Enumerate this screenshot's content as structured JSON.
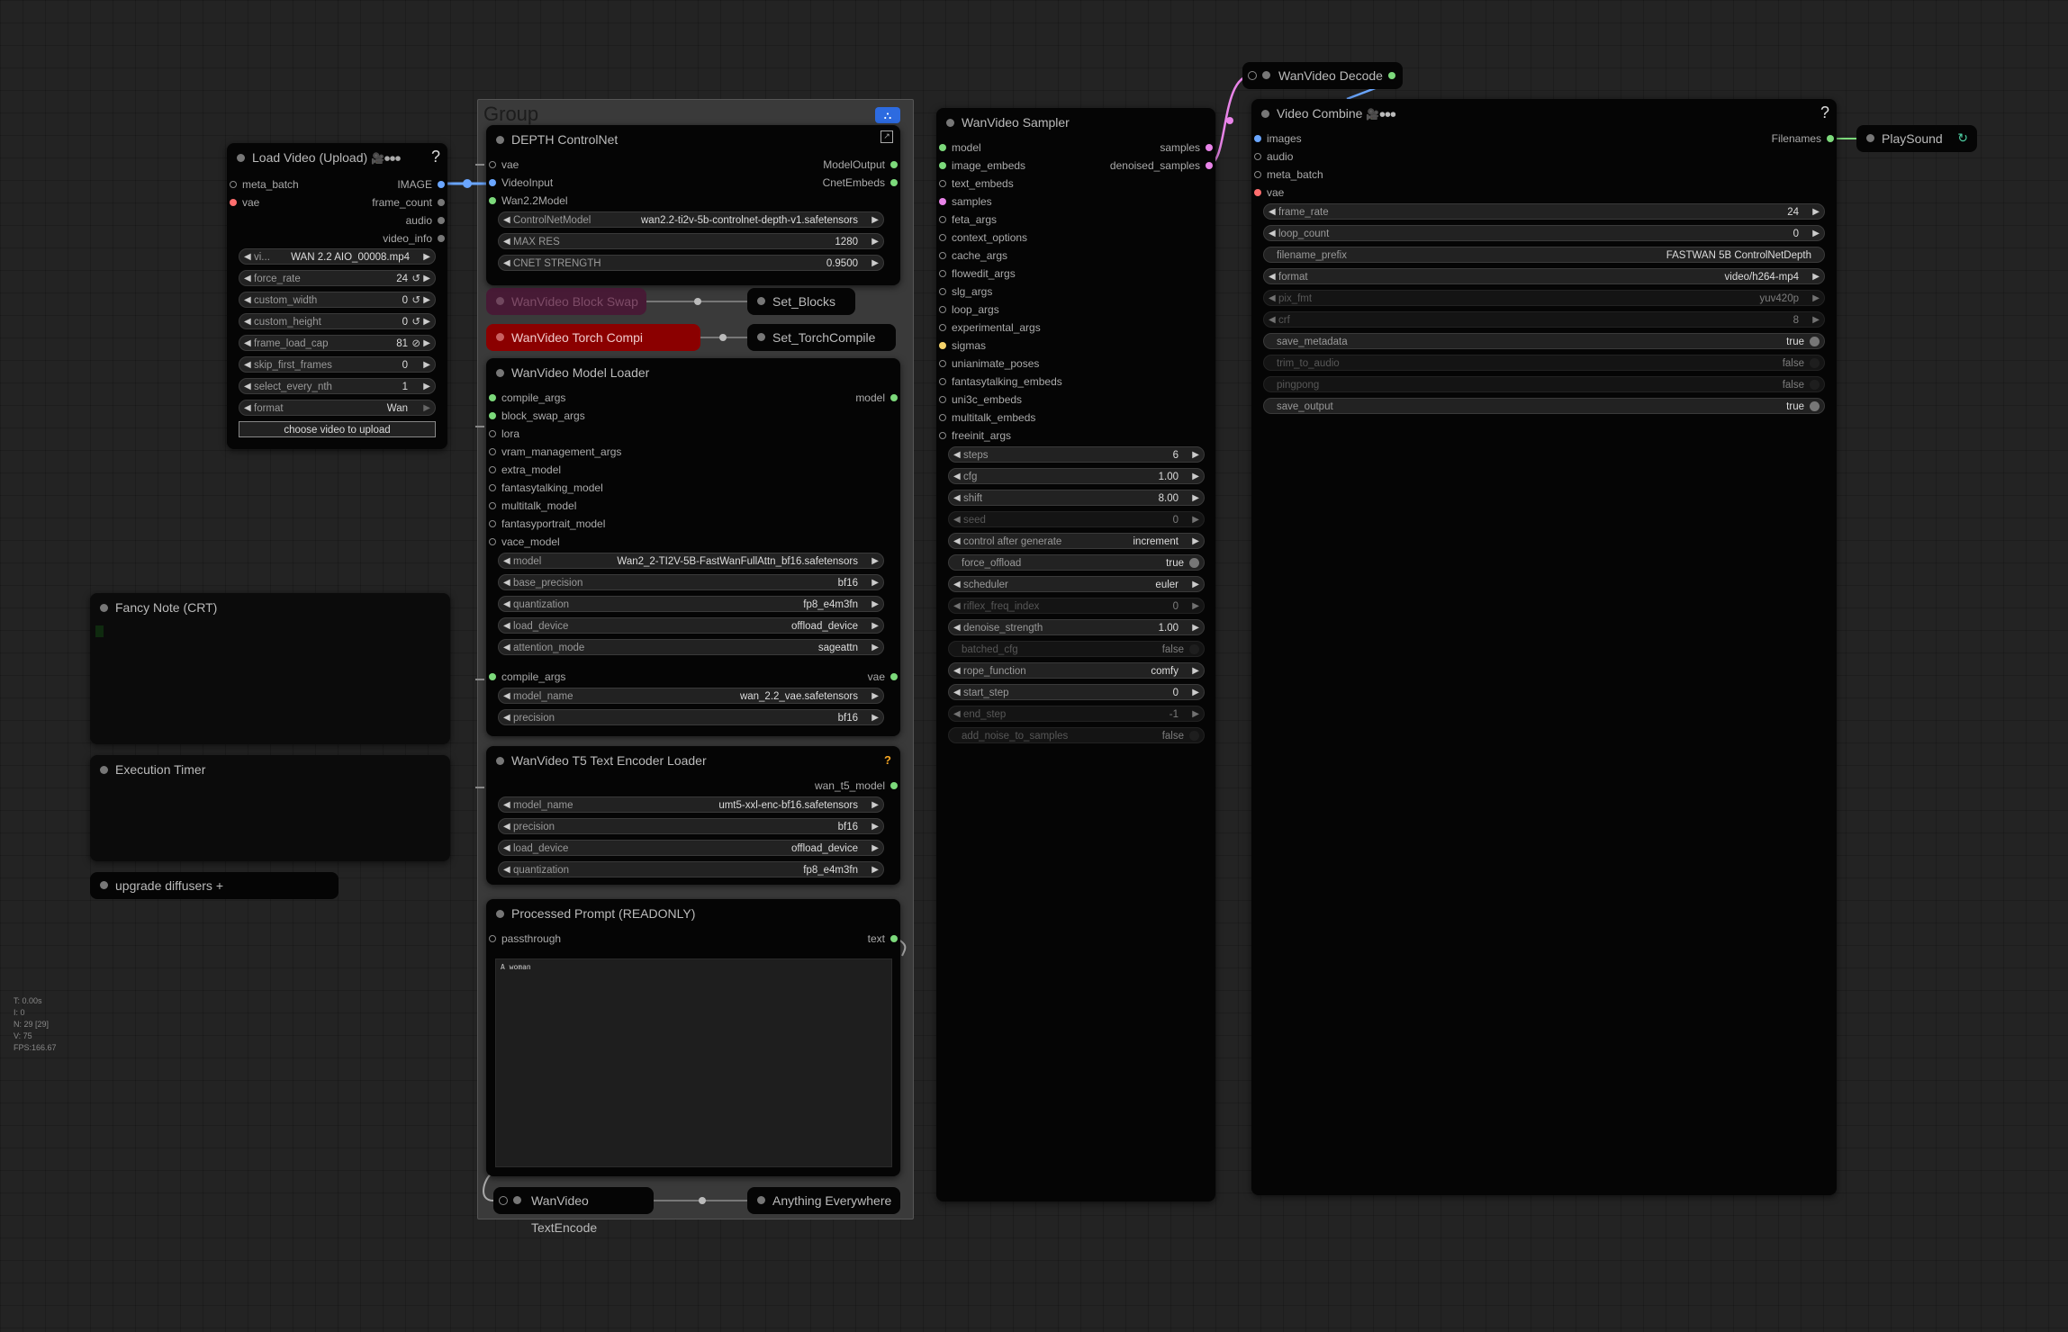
{
  "group": {
    "title": "Group"
  },
  "load_video": {
    "title": "Load Video (Upload)",
    "inputs": [
      "meta_batch",
      "vae"
    ],
    "outputs": [
      "IMAGE",
      "frame_count",
      "audio",
      "video_info"
    ],
    "widgets": [
      {
        "label": "vi...",
        "value": "WAN 2.2 AIO_00008.mp4"
      },
      {
        "label": "force_rate",
        "value": "24"
      },
      {
        "label": "custom_width",
        "value": "0"
      },
      {
        "label": "custom_height",
        "value": "0"
      },
      {
        "label": "frame_load_cap",
        "value": "81"
      },
      {
        "label": "skip_first_frames",
        "value": "0"
      },
      {
        "label": "select_every_nth",
        "value": "1"
      },
      {
        "label": "format",
        "value": "Wan"
      }
    ],
    "upload_button": "choose video to upload"
  },
  "depth_controlnet": {
    "title": "DEPTH ControlNet",
    "inputs": [
      "vae",
      "VideoInput",
      "Wan2.2Model"
    ],
    "outputs": [
      "ModelOutput",
      "CnetEmbeds"
    ],
    "widgets": [
      {
        "label": "ControlNetModel",
        "value": "wan2.2-ti2v-5b-controlnet-depth-v1.safetensors"
      },
      {
        "label": "MAX RES",
        "value": "1280"
      },
      {
        "label": "CNET STRENGTH",
        "value": "0.9500"
      }
    ]
  },
  "block_swap": {
    "title": "WanVideo Block Swap",
    "target": "Set_Blocks"
  },
  "torch_compile": {
    "title": "WanVideo Torch Compi",
    "target": "Set_TorchCompile"
  },
  "model_loader": {
    "title": "WanVideo Model Loader",
    "inputs": [
      "compile_args",
      "block_swap_args",
      "lora",
      "vram_management_args",
      "extra_model",
      "fantasytalking_model",
      "multitalk_model",
      "fantasyportrait_model",
      "vace_model"
    ],
    "output": "model",
    "widgets": [
      {
        "label": "model",
        "value": "Wan2_2-TI2V-5B-FastWanFullAttn_bf16.safetensors"
      },
      {
        "label": "base_precision",
        "value": "bf16"
      },
      {
        "label": "quantization",
        "value": "fp8_e4m3fn"
      },
      {
        "label": "load_device",
        "value": "offload_device"
      },
      {
        "label": "attention_mode",
        "value": "sageattn"
      }
    ],
    "vae_input": "compile_args",
    "vae_output": "vae",
    "vae_widgets": [
      {
        "label": "model_name",
        "value": "wan_2.2_vae.safetensors"
      },
      {
        "label": "precision",
        "value": "bf16"
      }
    ]
  },
  "t5_loader": {
    "title": "WanVideo T5 Text Encoder Loader",
    "output": "wan_t5_model",
    "widgets": [
      {
        "label": "model_name",
        "value": "umt5-xxl-enc-bf16.safetensors"
      },
      {
        "label": "precision",
        "value": "bf16"
      },
      {
        "label": "load_device",
        "value": "offload_device"
      },
      {
        "label": "quantization",
        "value": "fp8_e4m3fn"
      }
    ]
  },
  "processed_prompt": {
    "title": "Processed Prompt (READONLY)",
    "input": "passthrough",
    "output": "text",
    "text": "A woman"
  },
  "text_encode": {
    "title": "WanVideo TextEncode",
    "target": "Anything Everywhere"
  },
  "sampler": {
    "title": "WanVideo Sampler",
    "inputs": [
      "model",
      "image_embeds",
      "text_embeds",
      "samples",
      "feta_args",
      "context_options",
      "cache_args",
      "flowedit_args",
      "slg_args",
      "loop_args",
      "experimental_args",
      "sigmas",
      "unianimate_poses",
      "fantasytalking_embeds",
      "uni3c_embeds",
      "multitalk_embeds",
      "freeinit_args"
    ],
    "outputs": [
      "samples",
      "denoised_samples"
    ],
    "widgets": [
      {
        "label": "steps",
        "value": "6",
        "type": "num"
      },
      {
        "label": "cfg",
        "value": "1.00",
        "type": "num"
      },
      {
        "label": "shift",
        "value": "8.00",
        "type": "num"
      },
      {
        "label": "seed",
        "value": "0",
        "type": "num",
        "dim": true
      },
      {
        "label": "control after generate",
        "value": "increment",
        "type": "num"
      },
      {
        "label": "force_offload",
        "value": "true",
        "type": "toggle"
      },
      {
        "label": "scheduler",
        "value": "euler",
        "type": "num"
      },
      {
        "label": "riflex_freq_index",
        "value": "0",
        "type": "num",
        "dim": true
      },
      {
        "label": "denoise_strength",
        "value": "1.00",
        "type": "num"
      },
      {
        "label": "batched_cfg",
        "value": "false",
        "type": "toggle",
        "dim": true
      },
      {
        "label": "rope_function",
        "value": "comfy",
        "type": "num"
      },
      {
        "label": "start_step",
        "value": "0",
        "type": "num"
      },
      {
        "label": "end_step",
        "value": "-1",
        "type": "num",
        "dim": true
      },
      {
        "label": "add_noise_to_samples",
        "value": "false",
        "type": "toggle",
        "dim": true
      }
    ]
  },
  "decode": {
    "title": "WanVideo Decode"
  },
  "video_combine": {
    "title": "Video Combine",
    "inputs": [
      "images",
      "audio",
      "meta_batch",
      "vae"
    ],
    "output": "Filenames",
    "widgets": [
      {
        "label": "frame_rate",
        "value": "24",
        "type": "num"
      },
      {
        "label": "loop_count",
        "value": "0",
        "type": "num"
      },
      {
        "label": "filename_prefix",
        "value": "FASTWAN 5B ControlNetDepth",
        "type": "text"
      },
      {
        "label": "format",
        "value": "video/h264-mp4",
        "type": "num"
      },
      {
        "label": "pix_fmt",
        "value": "yuv420p",
        "type": "num",
        "dim": true
      },
      {
        "label": "crf",
        "value": "8",
        "type": "num",
        "dim": true
      },
      {
        "label": "save_metadata",
        "value": "true",
        "type": "toggle"
      },
      {
        "label": "trim_to_audio",
        "value": "false",
        "type": "toggle",
        "dim": true
      },
      {
        "label": "pingpong",
        "value": "false",
        "type": "toggle",
        "dim": true
      },
      {
        "label": "save_output",
        "value": "true",
        "type": "toggle"
      }
    ]
  },
  "playsound": {
    "title": "PlaySound"
  },
  "fancy_note": {
    "title": "Fancy Note (CRT)"
  },
  "exec_timer": {
    "title": "Execution Timer"
  },
  "upgrade": {
    "title": "upgrade diffusers +"
  },
  "stats": [
    "T: 0.00s",
    "I: 0",
    "N: 29 [29]",
    "V: 75",
    "FPS:166.67"
  ],
  "colors": {
    "canvas": "#232323",
    "node": "#050505",
    "link_pink": "#e884e8",
    "link_blue": "#6aa6ff",
    "torch_red": "#8b0000",
    "block_swap": "#4a1535"
  }
}
